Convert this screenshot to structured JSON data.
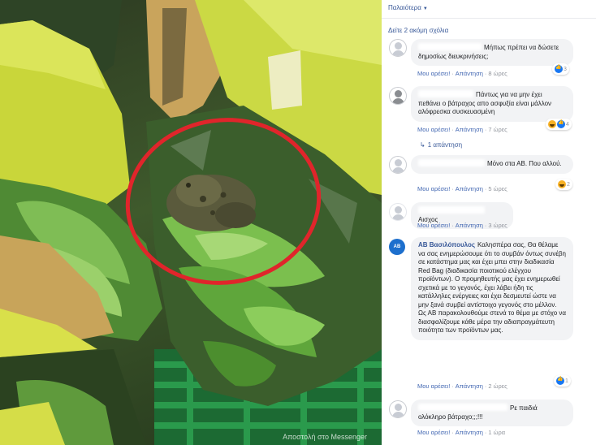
{
  "photo": {
    "caption": "Αποστολή στο Messenger"
  },
  "comments_panel": {
    "filter_label": "Παλαιότερα",
    "see_more_replies": "Δείτε 2 ακόμη σχόλια",
    "like_label": "Μου αρέσει!",
    "reply_label": "Απάντηση",
    "comments": [
      {
        "text": "Μήπως πρέπει να δώσετε δημοσίως διευκρινήσεις;",
        "time": "8 ώρες",
        "reaction_count": "3",
        "reactions": [
          "like"
        ]
      },
      {
        "text": "Πάντως για να μην έχει πεθάνει ο βάτραχος απο ασφυξία είναι μάλλον αλόφρεσκα συσκευασμένη",
        "time": "7 ώρες",
        "reaction_count": "4",
        "reactions": [
          "haha",
          "like"
        ],
        "replies_link": "1 απάντηση"
      },
      {
        "text": "Μόνο στα ΑΒ. Που αλλού.",
        "time": "5 ώρες",
        "reaction_count": "2",
        "reactions": [
          "haha"
        ]
      },
      {
        "text": "Αισχος",
        "time": "3 ώρες"
      },
      {
        "author": "ΑΒ Βασιλόπουλος",
        "avatar_text": "ΑΒ",
        "text": "Καλησπέρα σας, Θα θέλαμε να σας ενημερώσουμε ότι το συμβάν όντως συνέβη σε κατάστημα μας και έχει μπει στην διαδικασία Red Bag (διαδικασία ποιοτικού ελέγχου προϊόντων). Ο προμηθευτής μας έχει ενημερωθεί σχετικά με το γεγονός, έχει λάβει ήδη τις κατάλληλες ενέργειες και έχει δεσμευτεί ώστε να μην ξανά συμβεί αντίστοιχο γεγονός στο μέλλον. Ως ΑΒ παρακολουθούμε στενά το θέμα με στόχο να διασφαλίζουμε κάθε μέρα την αδιαπραγμάτευτη ποιότητα των προϊόντων μας.",
        "time": "2 ώρες",
        "reaction_count": "1",
        "reactions": [
          "like"
        ]
      },
      {
        "text": "Ρε παιδιά ολόκληρο βάτραχο;;;!!!",
        "time": "1 ώρα"
      }
    ]
  },
  "colors": {
    "link_blue": "#385898",
    "bubble_bg": "#f2f3f5",
    "bag_yellow": "#c9d63a",
    "circle_red": "#e0252b"
  },
  "icons": [
    "user-avatar-placeholder",
    "like-reaction-icon",
    "haha-reaction-icon",
    "reply-arrow-icon",
    "dropdown-caret-icon"
  ]
}
